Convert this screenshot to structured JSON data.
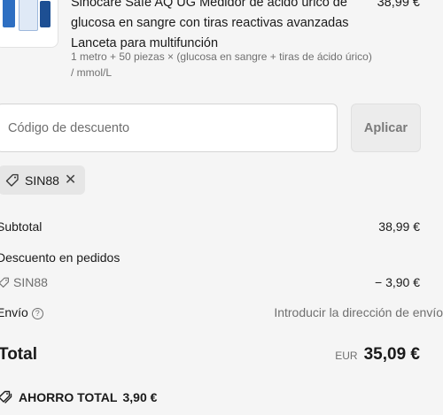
{
  "product": {
    "title": "Sinocare Safe AQ UG Medidor de ácido úrico de glucosa en sangre con tiras reactivas avanzadas Lanceta para multifunción",
    "price": "38,99 €",
    "variant": "1 metro + 50 piezas × (glucosa en sangre + tiras de ácido úrico) / mmol/L"
  },
  "discount": {
    "placeholder": "Código de descuento",
    "apply_label": "Aplicar",
    "applied_code": "SIN88"
  },
  "summary": {
    "subtotal_label": "Subtotal",
    "subtotal_value": "38,99 €",
    "order_discount_label": "Descuento en pedidos",
    "order_discount_code": "SIN88",
    "order_discount_value": "− 3,90 €",
    "shipping_label": "Envío",
    "shipping_value": "Introducir la dirección de envío",
    "total_label": "Total",
    "total_currency": "EUR",
    "total_value": "35,09 €",
    "savings_label": "AHORRO TOTAL",
    "savings_value": "3,90 €"
  },
  "icons": {
    "tag": "tag-icon",
    "remove": "close-icon",
    "help": "help-circle-icon",
    "savings": "tags-icon"
  }
}
